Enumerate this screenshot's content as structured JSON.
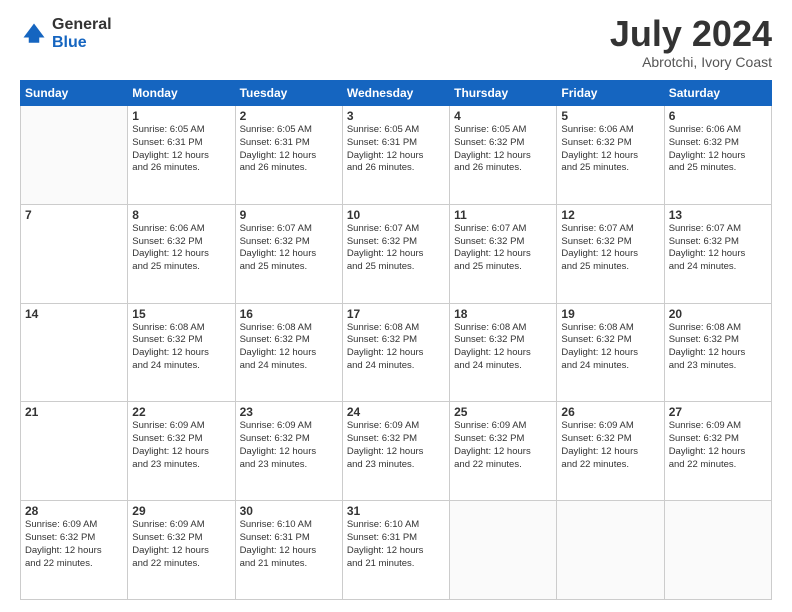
{
  "header": {
    "logo_general": "General",
    "logo_blue": "Blue",
    "month_year": "July 2024",
    "location": "Abrotchi, Ivory Coast"
  },
  "days_of_week": [
    "Sunday",
    "Monday",
    "Tuesday",
    "Wednesday",
    "Thursday",
    "Friday",
    "Saturday"
  ],
  "weeks": [
    [
      {
        "day": "",
        "text": ""
      },
      {
        "day": "1",
        "text": "Sunrise: 6:05 AM\nSunset: 6:31 PM\nDaylight: 12 hours\nand 26 minutes."
      },
      {
        "day": "2",
        "text": "Sunrise: 6:05 AM\nSunset: 6:31 PM\nDaylight: 12 hours\nand 26 minutes."
      },
      {
        "day": "3",
        "text": "Sunrise: 6:05 AM\nSunset: 6:31 PM\nDaylight: 12 hours\nand 26 minutes."
      },
      {
        "day": "4",
        "text": "Sunrise: 6:05 AM\nSunset: 6:32 PM\nDaylight: 12 hours\nand 26 minutes."
      },
      {
        "day": "5",
        "text": "Sunrise: 6:06 AM\nSunset: 6:32 PM\nDaylight: 12 hours\nand 25 minutes."
      },
      {
        "day": "6",
        "text": "Sunrise: 6:06 AM\nSunset: 6:32 PM\nDaylight: 12 hours\nand 25 minutes."
      }
    ],
    [
      {
        "day": "7",
        "text": ""
      },
      {
        "day": "8",
        "text": "Sunrise: 6:06 AM\nSunset: 6:32 PM\nDaylight: 12 hours\nand 25 minutes."
      },
      {
        "day": "9",
        "text": "Sunrise: 6:07 AM\nSunset: 6:32 PM\nDaylight: 12 hours\nand 25 minutes."
      },
      {
        "day": "10",
        "text": "Sunrise: 6:07 AM\nSunset: 6:32 PM\nDaylight: 12 hours\nand 25 minutes."
      },
      {
        "day": "11",
        "text": "Sunrise: 6:07 AM\nSunset: 6:32 PM\nDaylight: 12 hours\nand 25 minutes."
      },
      {
        "day": "12",
        "text": "Sunrise: 6:07 AM\nSunset: 6:32 PM\nDaylight: 12 hours\nand 25 minutes."
      },
      {
        "day": "13",
        "text": "Sunrise: 6:07 AM\nSunset: 6:32 PM\nDaylight: 12 hours\nand 24 minutes."
      }
    ],
    [
      {
        "day": "14",
        "text": ""
      },
      {
        "day": "15",
        "text": "Sunrise: 6:08 AM\nSunset: 6:32 PM\nDaylight: 12 hours\nand 24 minutes."
      },
      {
        "day": "16",
        "text": "Sunrise: 6:08 AM\nSunset: 6:32 PM\nDaylight: 12 hours\nand 24 minutes."
      },
      {
        "day": "17",
        "text": "Sunrise: 6:08 AM\nSunset: 6:32 PM\nDaylight: 12 hours\nand 24 minutes."
      },
      {
        "day": "18",
        "text": "Sunrise: 6:08 AM\nSunset: 6:32 PM\nDaylight: 12 hours\nand 24 minutes."
      },
      {
        "day": "19",
        "text": "Sunrise: 6:08 AM\nSunset: 6:32 PM\nDaylight: 12 hours\nand 24 minutes."
      },
      {
        "day": "20",
        "text": "Sunrise: 6:08 AM\nSunset: 6:32 PM\nDaylight: 12 hours\nand 23 minutes."
      }
    ],
    [
      {
        "day": "21",
        "text": ""
      },
      {
        "day": "22",
        "text": "Sunrise: 6:09 AM\nSunset: 6:32 PM\nDaylight: 12 hours\nand 23 minutes."
      },
      {
        "day": "23",
        "text": "Sunrise: 6:09 AM\nSunset: 6:32 PM\nDaylight: 12 hours\nand 23 minutes."
      },
      {
        "day": "24",
        "text": "Sunrise: 6:09 AM\nSunset: 6:32 PM\nDaylight: 12 hours\nand 23 minutes."
      },
      {
        "day": "25",
        "text": "Sunrise: 6:09 AM\nSunset: 6:32 PM\nDaylight: 12 hours\nand 22 minutes."
      },
      {
        "day": "26",
        "text": "Sunrise: 6:09 AM\nSunset: 6:32 PM\nDaylight: 12 hours\nand 22 minutes."
      },
      {
        "day": "27",
        "text": "Sunrise: 6:09 AM\nSunset: 6:32 PM\nDaylight: 12 hours\nand 22 minutes."
      }
    ],
    [
      {
        "day": "28",
        "text": "Sunrise: 6:09 AM\nSunset: 6:32 PM\nDaylight: 12 hours\nand 22 minutes."
      },
      {
        "day": "29",
        "text": "Sunrise: 6:09 AM\nSunset: 6:32 PM\nDaylight: 12 hours\nand 22 minutes."
      },
      {
        "day": "30",
        "text": "Sunrise: 6:10 AM\nSunset: 6:31 PM\nDaylight: 12 hours\nand 21 minutes."
      },
      {
        "day": "31",
        "text": "Sunrise: 6:10 AM\nSunset: 6:31 PM\nDaylight: 12 hours\nand 21 minutes."
      },
      {
        "day": "",
        "text": ""
      },
      {
        "day": "",
        "text": ""
      },
      {
        "day": "",
        "text": ""
      }
    ]
  ]
}
